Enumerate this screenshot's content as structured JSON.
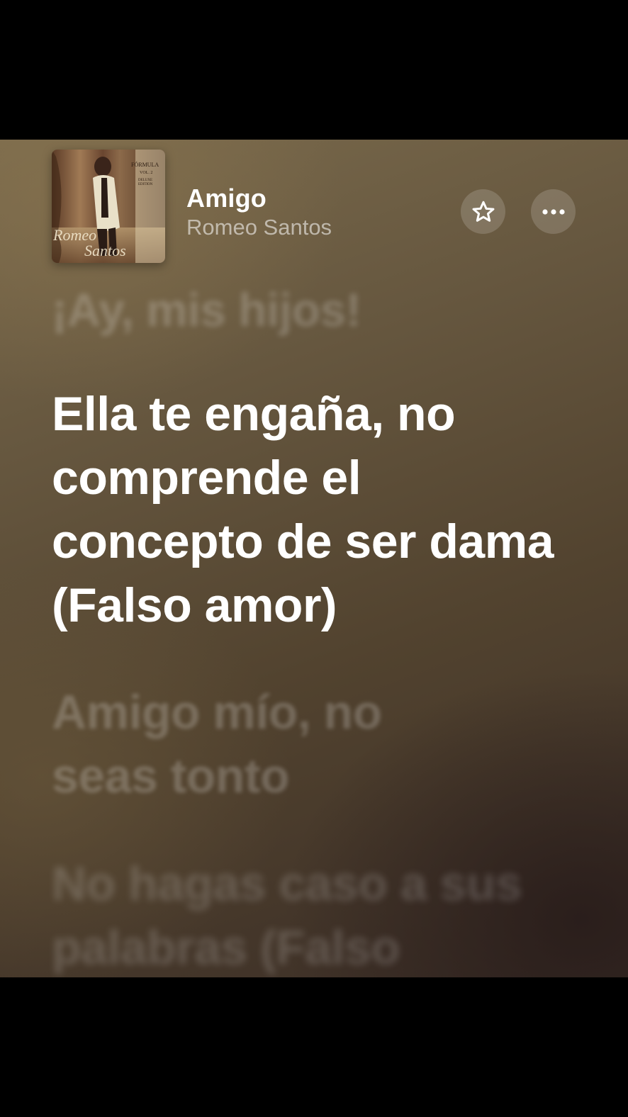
{
  "now_playing": {
    "title": "Amigo",
    "artist": "Romeo Santos",
    "album_art": {
      "label": "Romeo Santos",
      "subtitle": "FORMULA VOL. 2 DELUXE EDITION"
    }
  },
  "controls": {
    "favorite_icon": "star-icon",
    "more_icon": "ellipsis-icon"
  },
  "lyrics": {
    "previous": "¡Ay, mis hijos!",
    "current": "Ella te engaña, no comprende el concepto de ser dama (Falso amor)",
    "next": [
      "Amigo mío, no seas tonto",
      "No hagas caso a sus palabras (Falso"
    ]
  },
  "colors": {
    "background_top": "#7a6a4c",
    "background_bottom": "#3a2d26",
    "active_lyric": "#ffffff",
    "inactive_lyric": "rgba(255,255,255,0.22)"
  }
}
